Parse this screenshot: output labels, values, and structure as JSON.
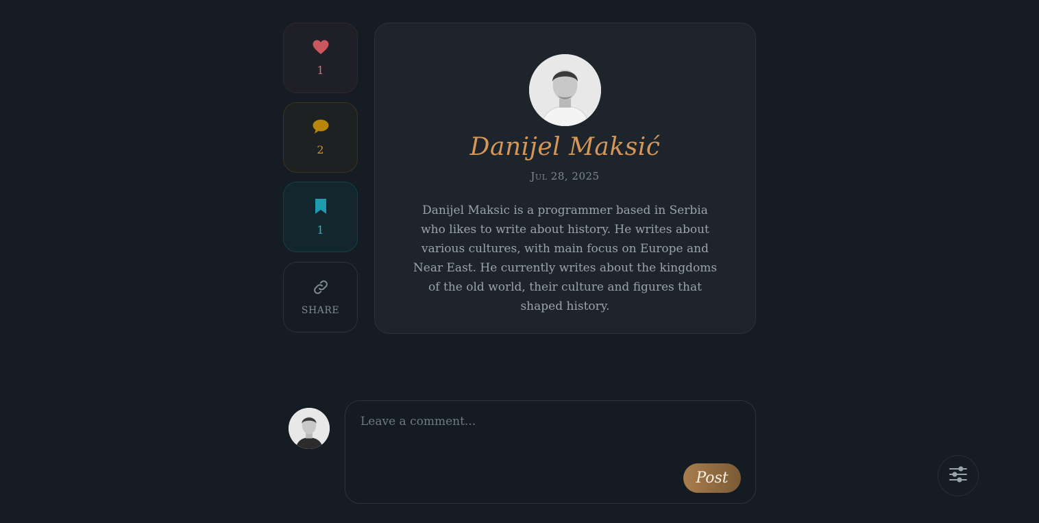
{
  "actions": {
    "like": {
      "icon": "heart-icon",
      "count": "1",
      "color": "#c9575d"
    },
    "comment": {
      "icon": "speech-bubble-icon",
      "count": "2",
      "color": "#b8860b"
    },
    "save": {
      "icon": "bookmark-icon",
      "count": "1",
      "color": "#1f9bb0"
    },
    "share": {
      "icon": "link-icon",
      "label": "SHARE"
    }
  },
  "author": {
    "name": "Danijel Maksić",
    "date": "Jul 28, 2025",
    "bio": "Danijel Maksic is a programmer based in Serbia who likes to write about history. He writes about various cultures, with main focus on Europe and Near East. He currently writes about the kingdoms of the old world, their culture and figures that shaped history."
  },
  "comment_box": {
    "placeholder": "Leave a comment...",
    "value": "",
    "post_label": "Post"
  },
  "settings": {
    "icon": "sliders-icon"
  },
  "colors": {
    "background": "#151c24",
    "card": "#1d242c",
    "accent_gold": "#d4975a"
  }
}
